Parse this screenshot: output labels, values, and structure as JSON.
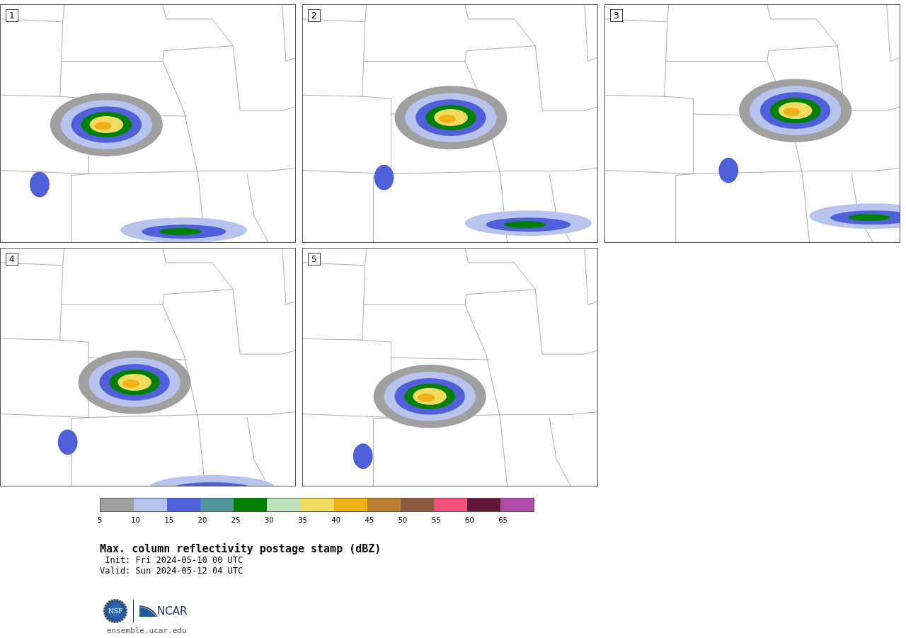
{
  "panels": [
    {
      "label": "1"
    },
    {
      "label": "2"
    },
    {
      "label": "3"
    },
    {
      "label": "4"
    },
    {
      "label": "5"
    }
  ],
  "colorbar": {
    "bins": [
      {
        "color": "#a0a0a0"
      },
      {
        "color": "#b8c4ee"
      },
      {
        "color": "#5060d8"
      },
      {
        "color": "#4f979c"
      },
      {
        "color": "#008000"
      },
      {
        "color": "#c0e0c0"
      },
      {
        "color": "#f0dc60"
      },
      {
        "color": "#f0b018"
      },
      {
        "color": "#b88030"
      },
      {
        "color": "#8a5a3e"
      },
      {
        "color": "#f5507c"
      },
      {
        "color": "#601838"
      },
      {
        "color": "#b04ca8"
      }
    ],
    "ticks": [
      "5",
      "10",
      "15",
      "20",
      "25",
      "30",
      "35",
      "40",
      "45",
      "50",
      "55",
      "60",
      "65"
    ]
  },
  "title": "Max. column reflectivity postage stamp (dBZ)",
  "init": " Init: Fri 2024-05-10 00 UTC",
  "valid": "Valid: Sun 2024-05-12 04 UTC",
  "logos": {
    "nsf": "NSF",
    "ncar": "NCAR"
  },
  "url": "ensemble.ucar.edu"
}
